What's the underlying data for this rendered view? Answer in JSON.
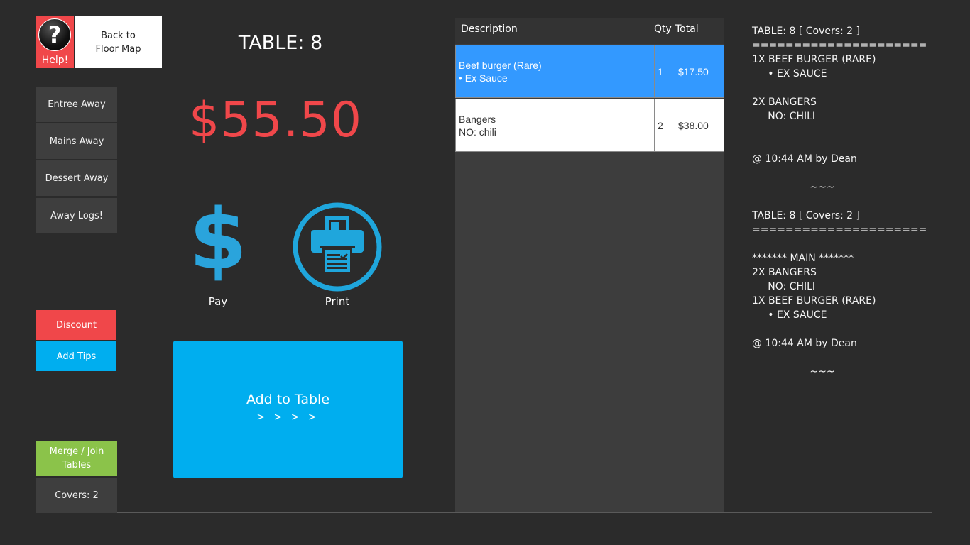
{
  "header": {
    "help_label": "Help!",
    "help_glyph": "?",
    "back_line1": "Back to",
    "back_line2": "Floor Map",
    "table_title": "TABLE: 8",
    "total_amount": "$55.50"
  },
  "sidebar": {
    "entree": "Entree Away",
    "mains": "Mains Away",
    "dessert": "Dessert Away",
    "away_logs": "Away Logs!",
    "discount": "Discount",
    "add_tips": "Add Tips",
    "merge_line1": "Merge / Join",
    "merge_line2": "Tables",
    "covers": "Covers: 2"
  },
  "actions": {
    "pay_glyph": "$",
    "pay_label": "Pay",
    "print_label": "Print",
    "print_icon": "printer-icon",
    "add_table_line1": "Add to Table",
    "add_table_line2": "> > > >"
  },
  "order": {
    "col_description": "Description",
    "col_qty": "Qty",
    "col_total": "Total",
    "items": [
      {
        "name": "Beef burger (Rare)",
        "modifier": " • Ex Sauce",
        "qty": "1",
        "total": "$17.50",
        "selected": true
      },
      {
        "name": "Bangers",
        "modifier": "NO: chili",
        "qty": "2",
        "total": "$38.00",
        "selected": false
      }
    ]
  },
  "ticket_log": {
    "lines": [
      "TABLE: 8 [ Covers: 2 ]",
      "=====================",
      "1X BEEF BURGER (RARE)",
      "     • EX SAUCE",
      "",
      "2X BANGERS",
      "     NO: CHILI",
      "",
      "",
      "@ 10:44 AM by Dean",
      "",
      "~~~",
      "",
      "TABLE: 8 [ Covers: 2 ]",
      "=====================",
      "",
      "******* MAIN *******",
      "2X BANGERS",
      "     NO: CHILI",
      "1X BEEF BURGER (RARE)",
      "     • EX SAUCE",
      "",
      "@ 10:44 AM by Dean",
      "",
      "~~~"
    ]
  },
  "colors": {
    "accent_blue": "#00aeef",
    "selected_row": "#3399ff",
    "alert_red": "#f0474a",
    "merge_green": "#8bc34a",
    "background": "#2b2b2b"
  }
}
